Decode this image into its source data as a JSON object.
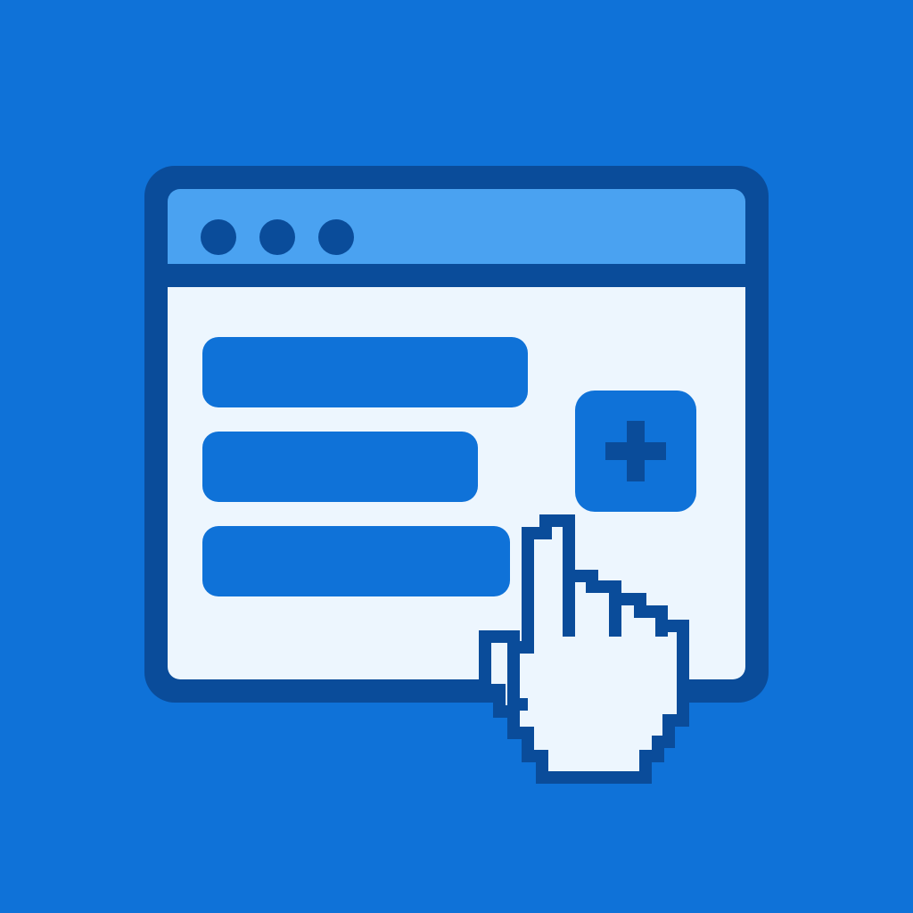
{
  "icon": {
    "name": "web-form-click-illustration",
    "window_controls": [
      "control-dot",
      "control-dot",
      "control-dot"
    ],
    "form_fields": [
      "text-field-placeholder",
      "text-field-placeholder",
      "text-field-placeholder"
    ],
    "action_icon": "plus-icon",
    "pointer_icon": "hand-pointer-icon"
  },
  "colors": {
    "background": "#0f72d8",
    "window_border": "#0a4c9a",
    "title_bar": "#4aa2f1",
    "content": "#edf6fe",
    "field_fill": "#0f72d8",
    "cursor_fill": "#edf6fe",
    "cursor_outline": "#0a4c9a"
  }
}
